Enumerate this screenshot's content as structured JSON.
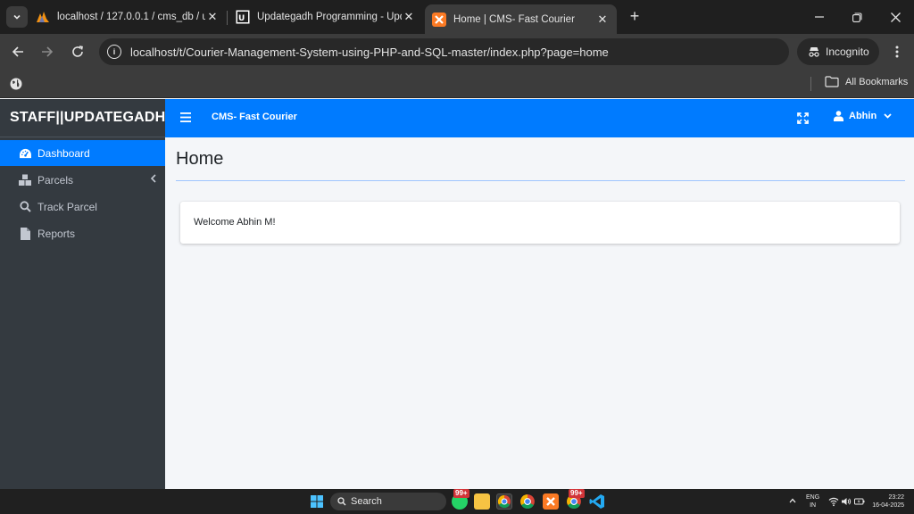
{
  "browser": {
    "tabs": [
      {
        "title": "localhost / 127.0.0.1 / cms_db / us",
        "icon": "phpmyadmin-icon"
      },
      {
        "title": "Updategadh Programming - Upda",
        "icon": "updategadh-icon"
      },
      {
        "title": "Home | CMS- Fast Courier",
        "icon": "xampp-icon",
        "active": true
      }
    ],
    "url": "localhost/t/Courier-Management-System-using-PHP-and-SQL-master/index.php?page=home",
    "incognito_label": "Incognito",
    "bookmarks_label": "All Bookmarks"
  },
  "sidebar": {
    "brand": "STAFF||UPDATEGADH",
    "items": [
      {
        "label": "Dashboard",
        "icon": "dashboard-icon",
        "active": true
      },
      {
        "label": "Parcels",
        "icon": "boxes-icon",
        "has_children": true
      },
      {
        "label": "Track Parcel",
        "icon": "search-icon"
      },
      {
        "label": "Reports",
        "icon": "file-icon"
      }
    ]
  },
  "navbar": {
    "title": "CMS- Fast Courier",
    "user": "Abhin"
  },
  "content": {
    "page_title": "Home",
    "welcome": "Welcome Abhin M!"
  },
  "taskbar": {
    "search_label": "Search",
    "badge_1": "99+",
    "badge_2": "99+",
    "lang_line1": "ENG",
    "lang_line2": "IN",
    "time": "23:22",
    "date": "16-04-2025"
  },
  "colors": {
    "primary": "#007bff",
    "sidebar_bg": "#343a40",
    "content_bg": "#f4f6f9"
  }
}
